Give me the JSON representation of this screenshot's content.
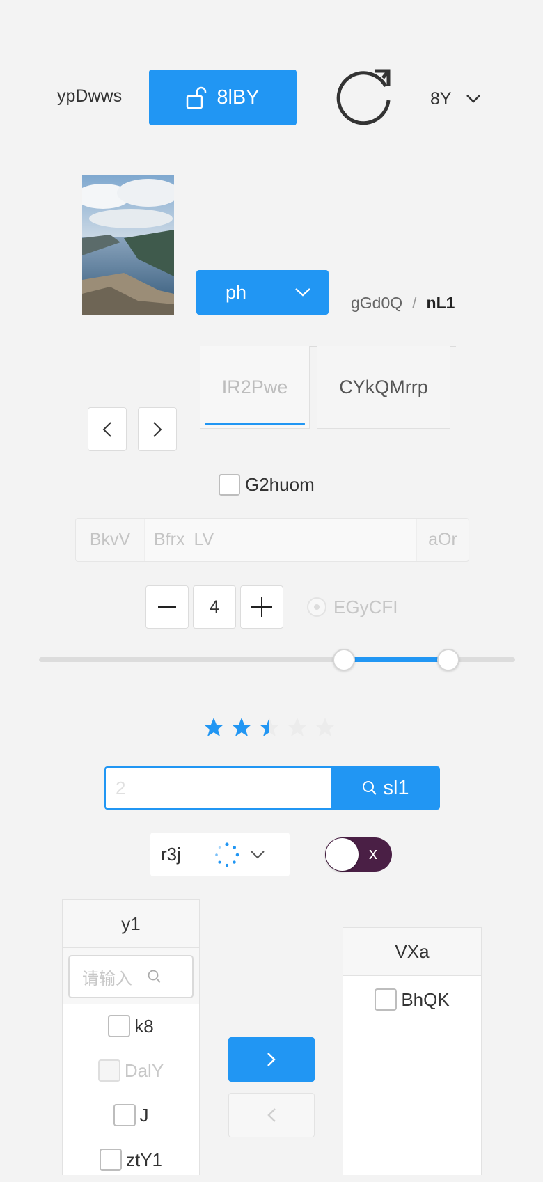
{
  "header": {
    "label": "ypDwws",
    "unlock_button": "8lBY",
    "select_value": "8Y"
  },
  "split_button": {
    "label": "ph"
  },
  "breadcrumb": {
    "items": [
      "gGd0Q",
      "nL1"
    ]
  },
  "tabs": {
    "items": [
      "IR2Pwe",
      "CYkQMrrp"
    ],
    "active_index": 0
  },
  "checkbox": {
    "label": "G2huom",
    "checked": false
  },
  "input_group": {
    "prefix": "BkvV",
    "inner_prefix": "Bfrx",
    "placeholder": "LV",
    "suffix": "aOr"
  },
  "stepper": {
    "value": "4"
  },
  "radio": {
    "label": "EGyCFI",
    "disabled": true
  },
  "range_slider": {
    "min": 0,
    "max": 100,
    "low": 64,
    "high": 86
  },
  "rating": {
    "value": 2.5,
    "max": 5
  },
  "search": {
    "value": "2",
    "button_label": "sl1"
  },
  "select": {
    "value": "r3j",
    "loading": true
  },
  "switch": {
    "label": "x",
    "on": true
  },
  "transfer": {
    "left": {
      "title": "y1",
      "search_placeholder": "请输入",
      "items": [
        {
          "label": "k8",
          "disabled": false
        },
        {
          "label": "DalY",
          "disabled": true
        },
        {
          "label": "J",
          "disabled": false
        },
        {
          "label": "ztY1",
          "disabled": false
        }
      ]
    },
    "right": {
      "title": "VXa",
      "items": [
        {
          "label": "BhQK",
          "disabled": false
        }
      ]
    }
  },
  "colors": {
    "accent": "#2196f3",
    "switch_bg": "#4a1f45",
    "text": "#333333",
    "muted": "#bdbdbd"
  },
  "icons": [
    "unlock-icon",
    "refresh-icon",
    "chevron-down-icon",
    "chevron-left-icon",
    "chevron-right-icon",
    "minus-icon",
    "plus-icon",
    "star-icon",
    "search-icon",
    "spinner-icon"
  ]
}
